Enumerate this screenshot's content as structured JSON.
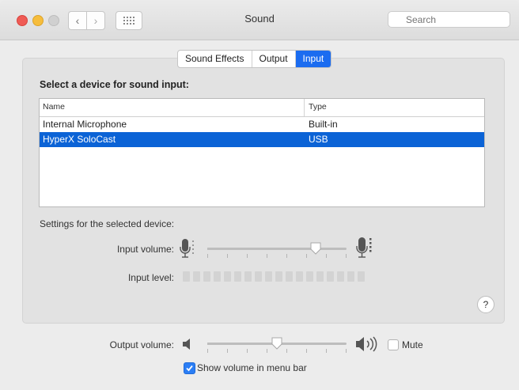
{
  "window": {
    "title": "Sound"
  },
  "search": {
    "placeholder": "Search"
  },
  "tabs": [
    {
      "label": "Sound Effects",
      "active": false
    },
    {
      "label": "Output",
      "active": false
    },
    {
      "label": "Input",
      "active": true
    }
  ],
  "input": {
    "section_title": "Select a device for sound input:",
    "columns": {
      "name": "Name",
      "type": "Type"
    },
    "devices": [
      {
        "name": "Internal Microphone",
        "type": "Built-in",
        "selected": false
      },
      {
        "name": "HyperX SoloCast",
        "type": "USB",
        "selected": true
      }
    ],
    "settings_title": "Settings for the selected device:",
    "input_volume_label": "Input volume:",
    "input_volume_value": 0.78,
    "input_level_label": "Input level:",
    "input_level_value": 0
  },
  "output": {
    "volume_label": "Output volume:",
    "volume_value": 0.5,
    "mute_label": "Mute",
    "mute_checked": false,
    "show_in_menu_bar_label": "Show volume in menu bar",
    "show_in_menu_bar_checked": true
  },
  "help": {
    "label": "?"
  },
  "colors": {
    "accent": "#1b6cf0",
    "selection": "#0b63d6"
  }
}
